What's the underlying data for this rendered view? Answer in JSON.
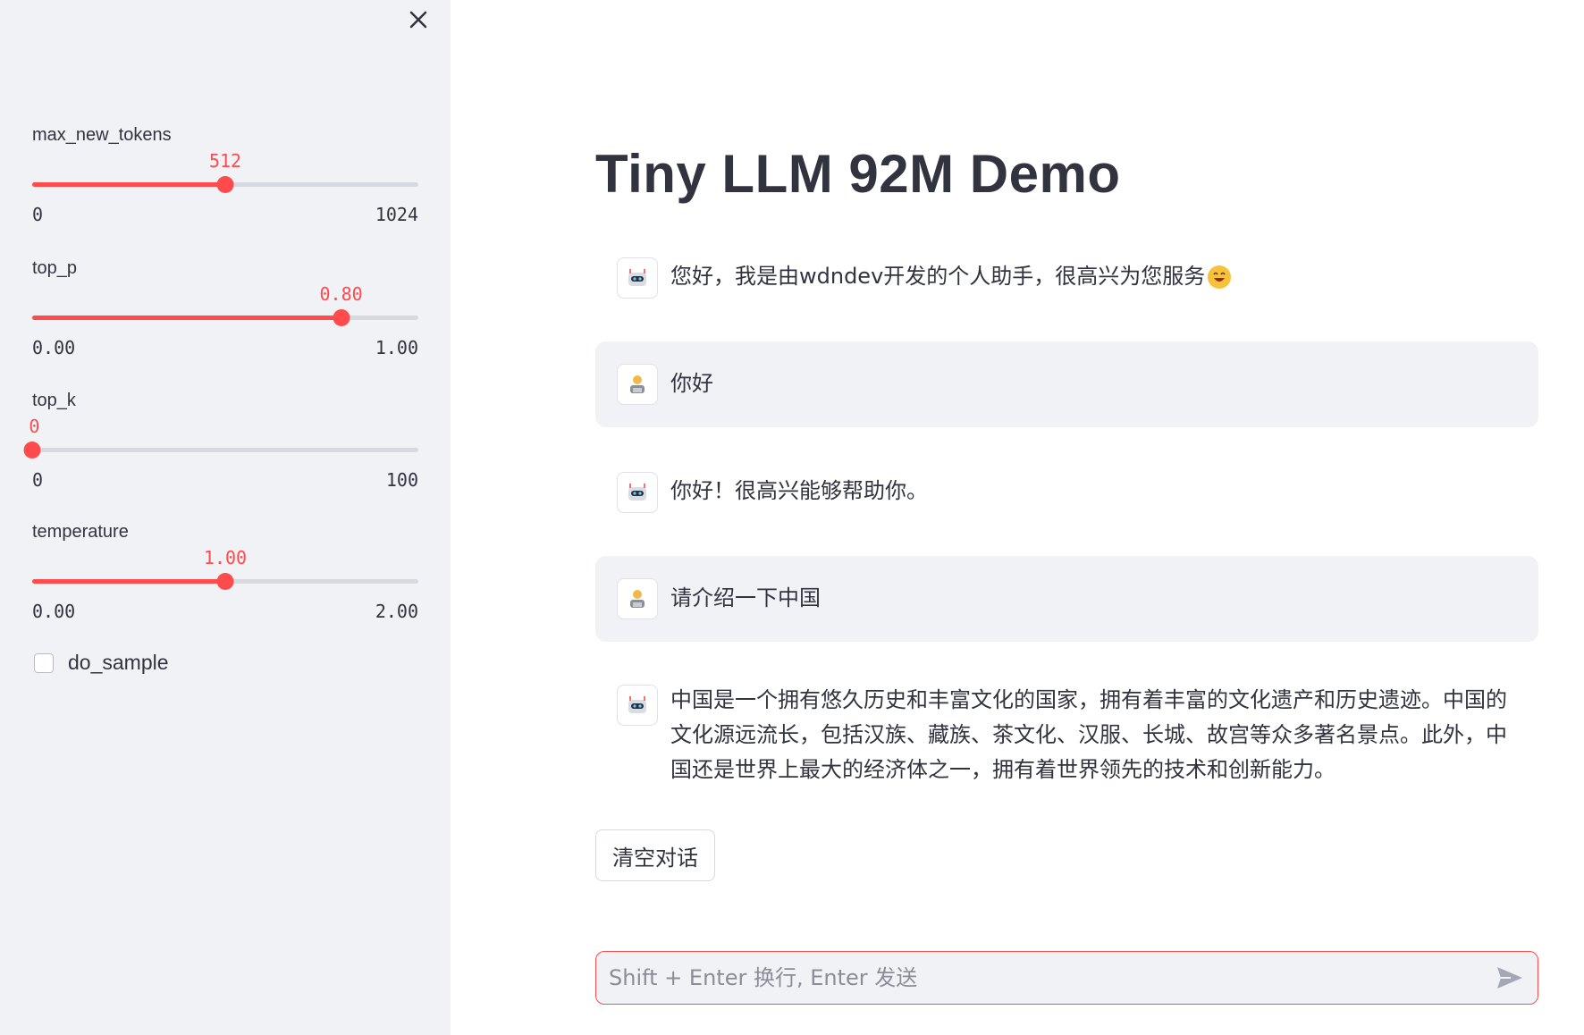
{
  "sidebar": {
    "close_icon": "close-icon",
    "sliders": [
      {
        "label": "max_new_tokens",
        "value": "512",
        "min": "0",
        "max": "1024",
        "fraction": 0.5
      },
      {
        "label": "top_p",
        "value": "0.80",
        "min": "0.00",
        "max": "1.00",
        "fraction": 0.8
      },
      {
        "label": "top_k",
        "value": "0",
        "min": "0",
        "max": "100",
        "fraction": 0.0
      },
      {
        "label": "temperature",
        "value": "1.00",
        "min": "0.00",
        "max": "2.00",
        "fraction": 0.5
      }
    ],
    "checkbox": {
      "label": "do_sample",
      "checked": false
    }
  },
  "main": {
    "title": "Tiny LLM 92M Demo",
    "messages": [
      {
        "role": "assistant",
        "avatar": "robot-avatar",
        "text": "您好，我是由wdndev开发的个人助手，很高兴为您服务",
        "emoji": "grinning-face-emoji"
      },
      {
        "role": "user",
        "avatar": "user-avatar",
        "text": "你好"
      },
      {
        "role": "assistant",
        "avatar": "robot-avatar",
        "text": "你好！很高兴能够帮助你。"
      },
      {
        "role": "user",
        "avatar": "user-avatar",
        "text": "请介绍一下中国"
      },
      {
        "role": "assistant",
        "avatar": "robot-avatar",
        "text": "中国是一个拥有悠久历史和丰富文化的国家，拥有着丰富的文化遗产和历史遗迹。中国的文化源远流长，包括汉族、藏族、茶文化、汉服、长城、故宫等众多著名景点。此外，中国还是世界上最大的经济体之一，拥有着世界领先的技术和创新能力。"
      }
    ],
    "clear_button": "清空对话",
    "chat_input": {
      "placeholder": "Shift + Enter 换行, Enter 发送",
      "value": ""
    },
    "send_icon": "send-icon"
  },
  "colors": {
    "accent": "#ff4b4b",
    "sidebar_bg": "#f0f2f6",
    "text": "#31333f",
    "track": "#d6d9e0"
  }
}
